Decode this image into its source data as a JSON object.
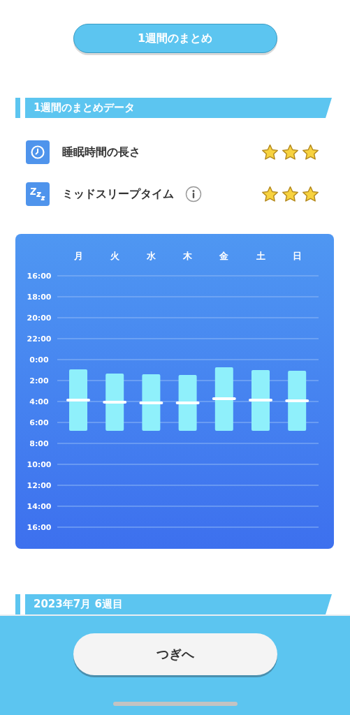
{
  "title_button": "1週間のまとめ",
  "summary_section": {
    "heading": "1週間のまとめデータ",
    "metrics": [
      {
        "kind": "clock",
        "label": "睡眠時間の長さ",
        "info": false,
        "stars": 3
      },
      {
        "kind": "zzz",
        "label": "ミッドスリープタイム",
        "info": true,
        "stars": 3
      }
    ],
    "time_labels": [
      "16:00",
      "18:00",
      "20:00",
      "22:00",
      "0:00",
      "2:00",
      "4:00",
      "6:00",
      "8:00",
      "10:00",
      "12:00",
      "14:00",
      "16:00"
    ],
    "day_labels": [
      "月",
      "火",
      "水",
      "木",
      "金",
      "土",
      "日"
    ]
  },
  "week_section": {
    "heading": "2023年7月 6週目"
  },
  "next_button": "つぎへ"
}
